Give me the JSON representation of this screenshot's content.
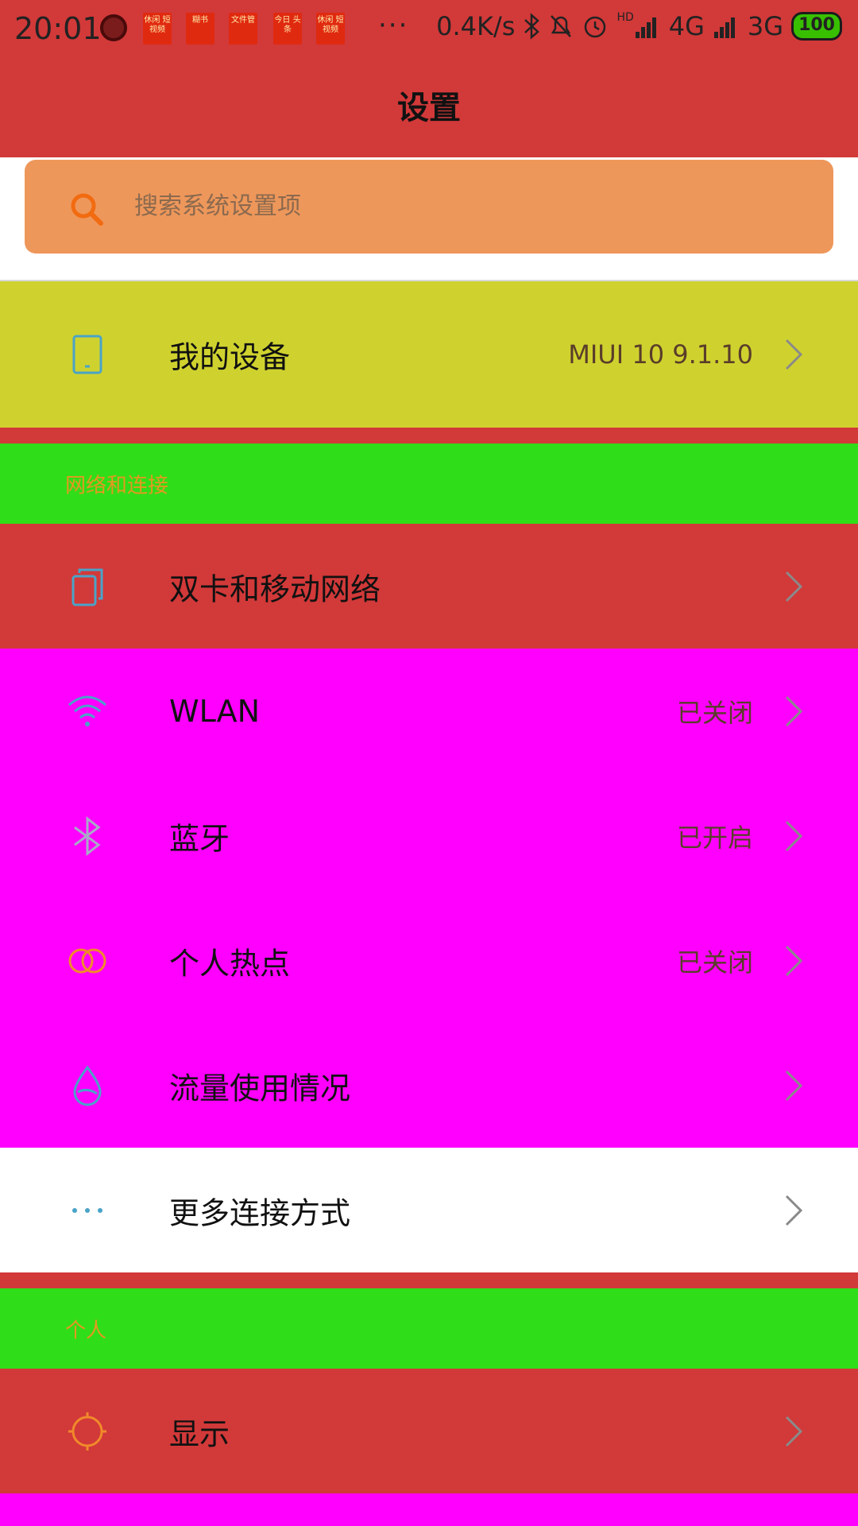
{
  "status_bar": {
    "time": "20:01",
    "notif_icons": [
      "休闲\n短视频",
      "糊书\n",
      " 文件管",
      "今日\n头条",
      "休闲\n短视频"
    ],
    "more": "···",
    "speed": "0.4K/s",
    "net1": "4G",
    "net2": "3G",
    "hd": "HD",
    "battery": "100"
  },
  "header": {
    "title": "设置"
  },
  "search": {
    "placeholder": "搜索系统设置项"
  },
  "my_device": {
    "label": "我的设备",
    "value": "MIUI 10 9.1.10"
  },
  "sections": {
    "network": "网络和连接",
    "personal": "个人"
  },
  "network_items": [
    {
      "label": "双卡和移动网络",
      "value": ""
    },
    {
      "label": "WLAN",
      "value": "已关闭"
    },
    {
      "label": "蓝牙",
      "value": "已开启"
    },
    {
      "label": "个人热点",
      "value": "已关闭"
    },
    {
      "label": "流量使用情况",
      "value": ""
    },
    {
      "label": "更多连接方式",
      "value": ""
    }
  ],
  "personal_items": [
    {
      "label": "显示",
      "value": ""
    }
  ],
  "colors": {
    "header_bg": "#d23939",
    "search_bg": "#ee975b",
    "device_bg": "#cfd22e",
    "section_bg": "#30dd19",
    "magenta": "#ff00ff",
    "section_text": "#e39a1f"
  }
}
